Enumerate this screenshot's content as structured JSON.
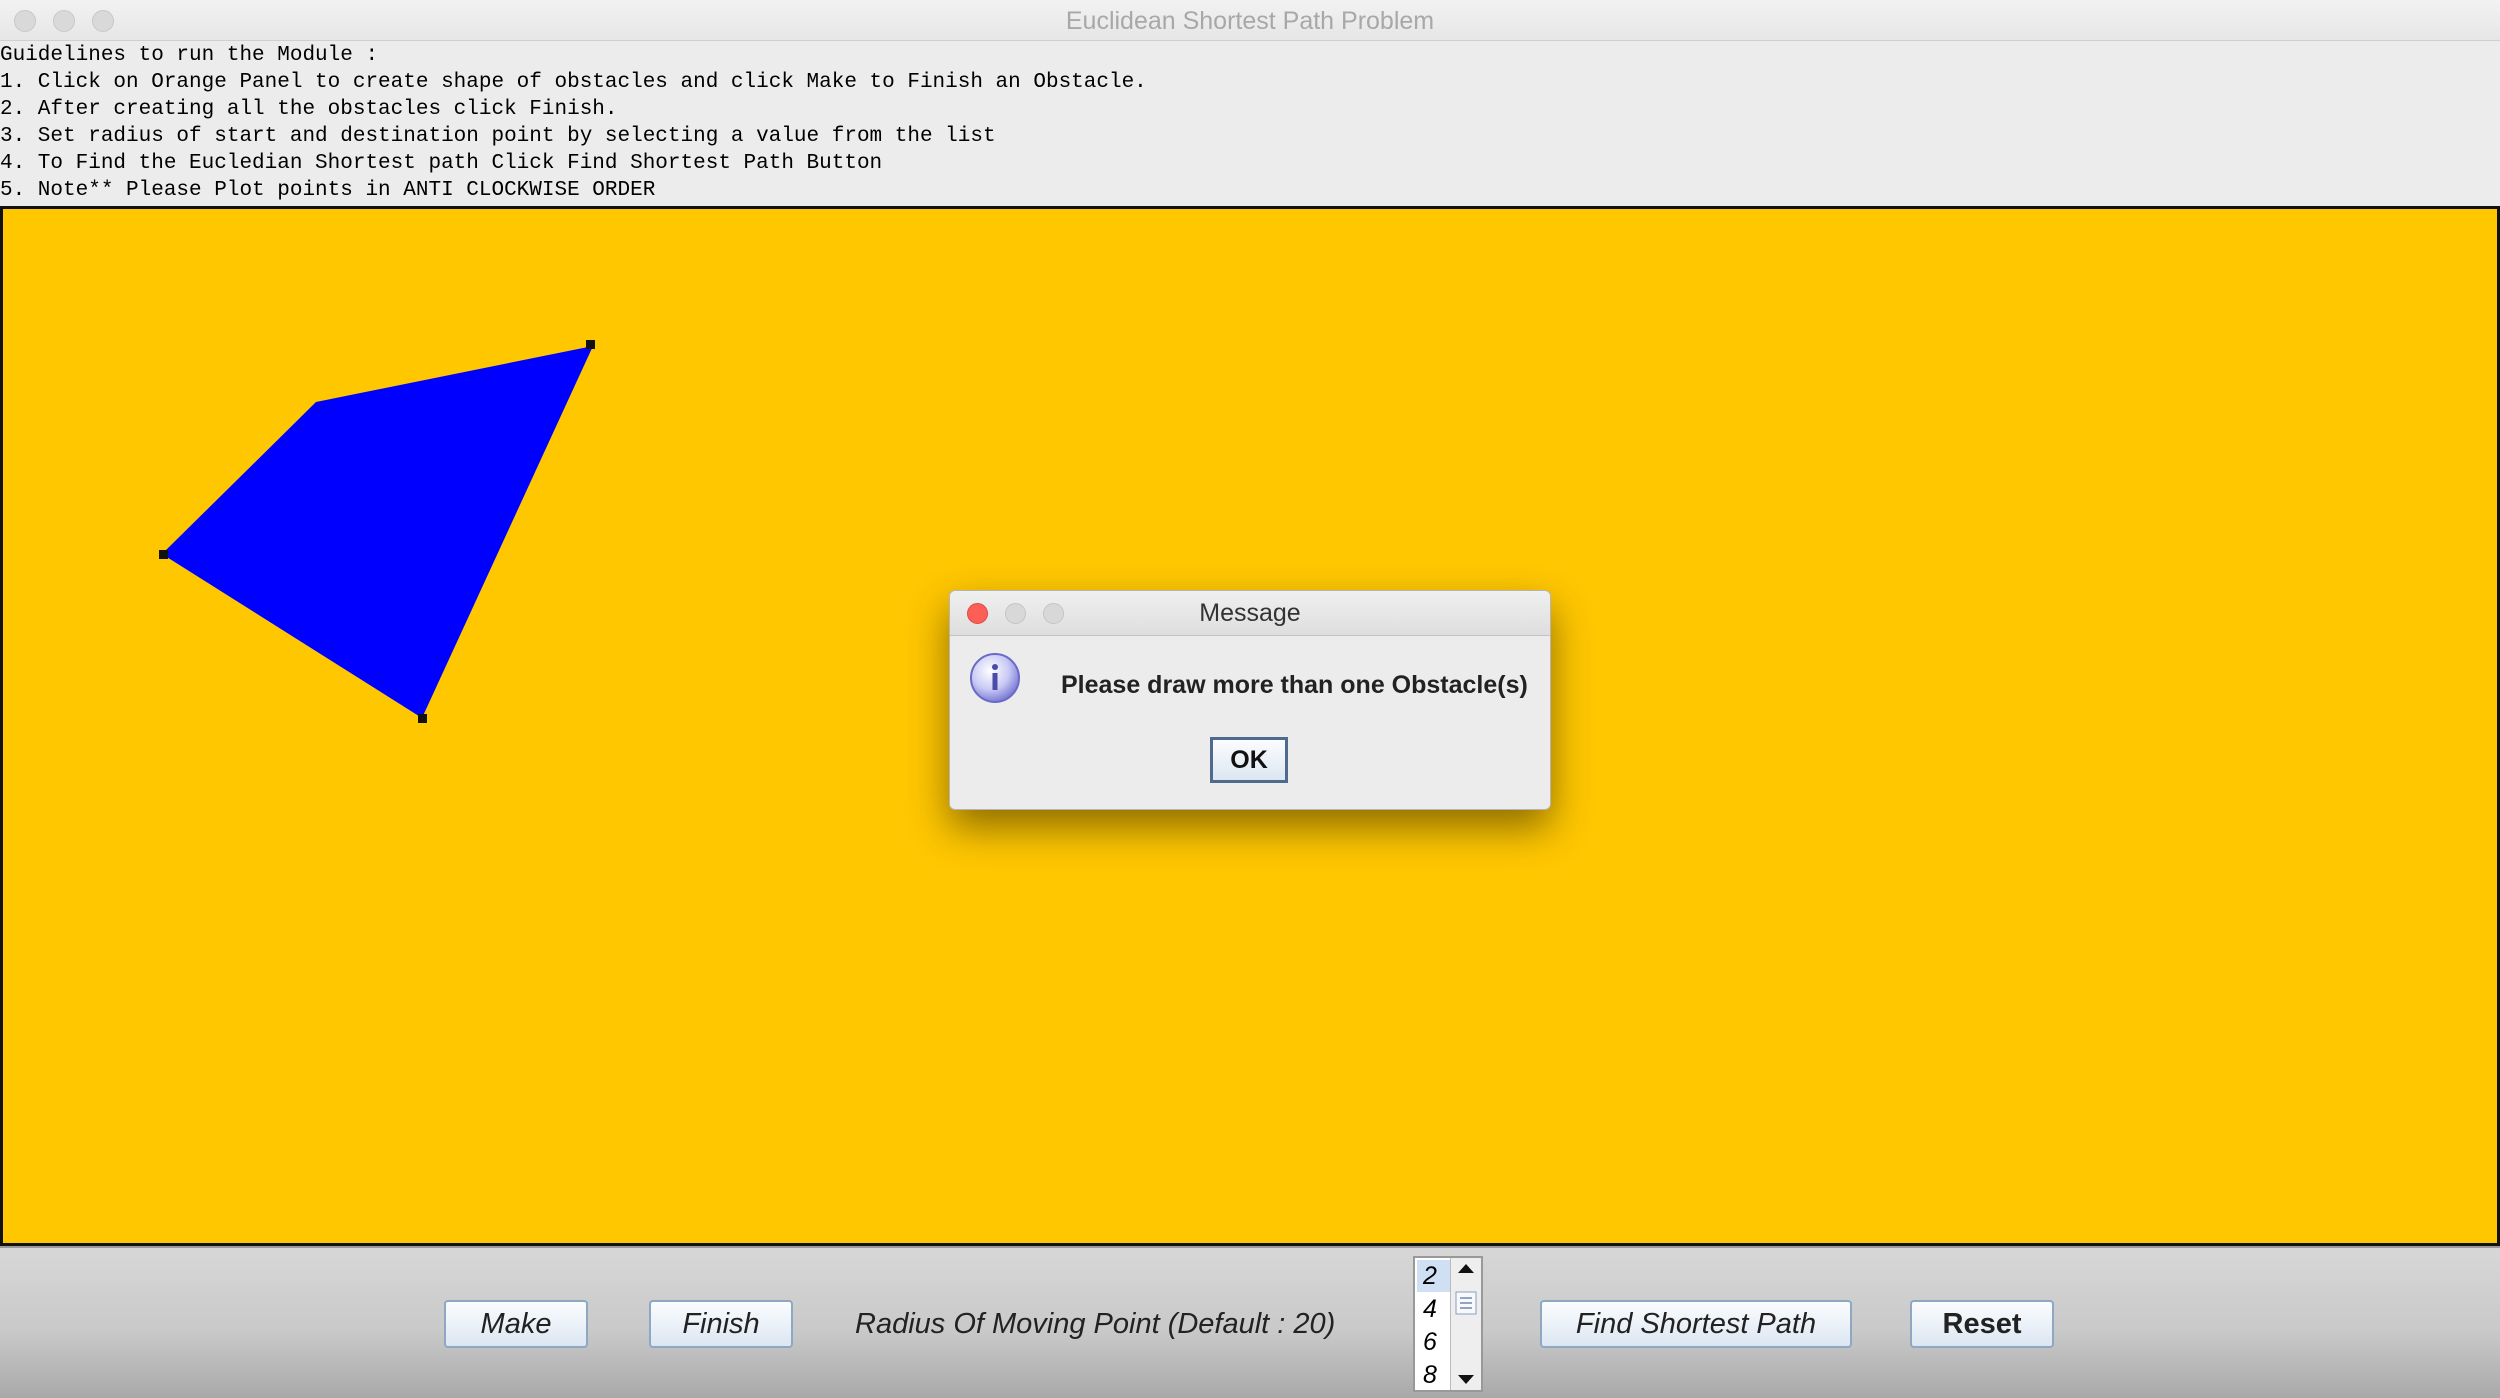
{
  "window": {
    "title": "Euclidean Shortest Path Problem"
  },
  "guidelines": [
    "Guidelines to run the Module :",
    "1. Click on Orange Panel to create shape of obstacles and click Make to Finish an Obstacle.",
    "2. After creating all the obstacles click Finish.",
    "3. Set radius of start and destination point by selecting a value from the list",
    "4. To Find the Eucledian Shortest path Click Find Shortest Path Button",
    "5. Note** Please Plot points in ANTI CLOCKWISE ORDER"
  ],
  "colors": {
    "panel": "#ffc700",
    "obstacle": "#0000ff"
  },
  "controls": {
    "make_label": "Make",
    "finish_label": "Finish",
    "radius_label": "Radius Of Moving Point (Default : 20)",
    "radius_options": [
      "2",
      "4",
      "6",
      "8"
    ],
    "radius_selected": "2",
    "find_label": "Find Shortest Path",
    "reset_label": "Reset"
  },
  "dialog": {
    "title": "Message",
    "icon": "info-icon",
    "message": "Please draw more than one Obstacle(s)",
    "ok_label": "OK"
  }
}
